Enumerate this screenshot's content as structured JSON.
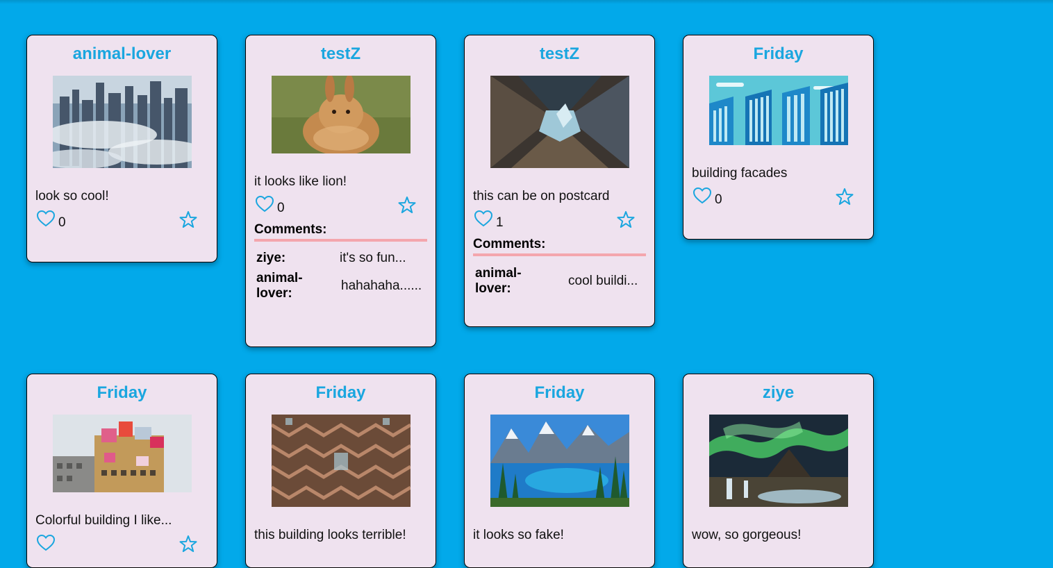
{
  "colors": {
    "background": "#02a9ea",
    "card": "#efe2ef",
    "title": "#1aa6df",
    "comment_underline": "#f4a6ad"
  },
  "posts": [
    {
      "user": "animal-lover",
      "caption": "look so cool!",
      "likes": "0",
      "image": "foggy-skyscrapers"
    },
    {
      "user": "testZ",
      "caption": "it looks like lion!",
      "likes": "0",
      "image": "fluffy-rabbit",
      "comments_label": "Comments:",
      "comments": [
        {
          "user": "ziye:",
          "text": "it's so fun..."
        },
        {
          "user": "animal-lover:",
          "text": "hahahaha......"
        }
      ]
    },
    {
      "user": "testZ",
      "caption": "this can be on postcard",
      "likes": "1",
      "image": "skyscrapers-looking-up",
      "comments_label": "Comments:",
      "comments": [
        {
          "user": "animal-lover:",
          "text": "cool buildi..."
        }
      ]
    },
    {
      "user": "Friday",
      "caption": "building facades",
      "likes": "0",
      "image": "illustrated-towers"
    },
    {
      "user": "Friday",
      "caption": "Colorful building I like...",
      "image": "colorful-building"
    },
    {
      "user": "Friday",
      "caption": "this building looks terrible!",
      "image": "honeycomb-structure"
    },
    {
      "user": "Friday",
      "caption": "it looks so fake!",
      "image": "mountain-lake"
    },
    {
      "user": "ziye",
      "caption": "wow, so gorgeous!",
      "image": "aurora-waterfall"
    }
  ]
}
